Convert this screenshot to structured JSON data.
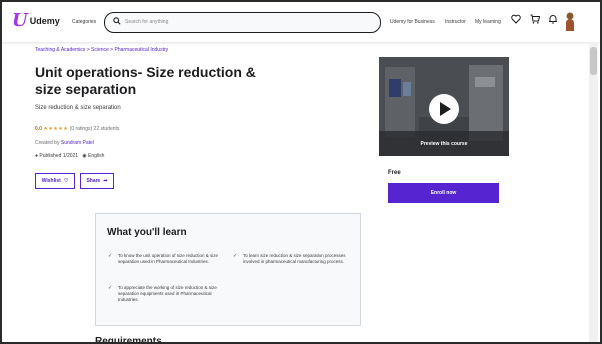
{
  "header": {
    "logo_text": "Udemy",
    "categories": "Categories",
    "search_placeholder": "Search for anything",
    "business": "Udemy for Business",
    "instructor": "Instructor",
    "my_learning": "My learning"
  },
  "course": {
    "breadcrumb": "Teaching & Academics  >  Science  >  Pharmaceutical Industry",
    "title": "Unit operations- Size reduction & size separation",
    "subtitle": "Size reduction & size separation",
    "rating_value": "0.0",
    "stars": "★★★★★",
    "rating_text": "(0 ratings)  22 students",
    "created_label": "Created by",
    "instructor_name": "Sundram Patel",
    "published": "Published 1/2021",
    "language": "English",
    "wishlist_label": "Wishlist",
    "share_label": "Share"
  },
  "sidebar": {
    "preview_label": "Preview this course",
    "price": "Free",
    "enroll_label": "Enroll now"
  },
  "learn": {
    "heading": "What you'll learn",
    "items": [
      "To know the unit operation of size reduction & size separation used in Pharmaceutical Industries.",
      "To learn size reduction & size separation processes involved in pharmaceutical manufacturing process.",
      "To appreciate the working of size reduction & size separation equipments used in Pharmaceutical Industries."
    ]
  },
  "requirements": {
    "heading": "Requirements"
  },
  "colors": {
    "brand": "#a435f0",
    "accent": "#5624d0",
    "rating": "#b4690e",
    "stars": "#e59819"
  },
  "icons": [
    "search-icon",
    "heart-icon",
    "cart-icon",
    "bell-icon",
    "globe-icon",
    "share-icon",
    "play-icon",
    "check-icon",
    "alert-icon"
  ]
}
